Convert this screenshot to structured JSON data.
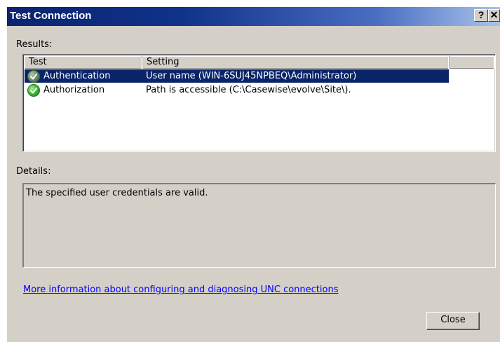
{
  "window": {
    "title": "Test Connection",
    "help_label": "?",
    "close_label": "✕"
  },
  "results": {
    "label": "Results:",
    "columns": [
      "Test",
      "Setting"
    ],
    "rows": [
      {
        "test": "Authentication",
        "setting": "User name (WIN-6SUJ45NPBEQ\\Administrator)",
        "selected": true,
        "icon": "check-icon"
      },
      {
        "test": "Authorization",
        "setting": "Path is accessible (C:\\Casewise\\evolve\\Site\\).",
        "selected": false,
        "icon": "check-icon"
      }
    ]
  },
  "details": {
    "label": "Details:",
    "text": "The specified user credentials are valid."
  },
  "link": {
    "text": "More information about configuring and diagnosing UNC connections"
  },
  "buttons": {
    "close": "Close"
  },
  "colors": {
    "title_bar_start": "#0b2470",
    "selection": "#0a246a",
    "dialog_face": "#d4d0c8",
    "link": "#0000ff"
  }
}
